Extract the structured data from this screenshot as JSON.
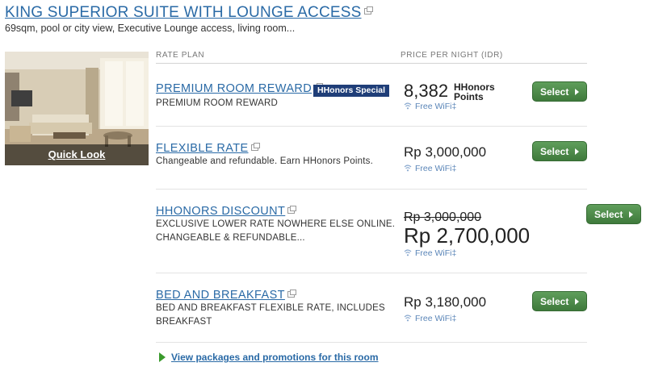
{
  "room": {
    "title": "KING SUPERIOR SUITE WITH LOUNGE ACCESS",
    "description": "69sqm, pool or city view, Executive Lounge access, living room...",
    "quick_look": "Quick Look"
  },
  "table": {
    "col_rate_plan": "RATE PLAN",
    "col_price": "PRICE PER NIGHT (IDR)"
  },
  "rates": [
    {
      "name": "PREMIUM ROOM REWARD",
      "badge": "HHonors Special",
      "description": "PREMIUM ROOM REWARD",
      "points": "8,382",
      "points_unit_line1": "HHonors",
      "points_unit_line2": "Points",
      "wifi": "Free WiFi‡",
      "select": "Select"
    },
    {
      "name": "FLEXIBLE RATE",
      "description": "Changeable and refundable. Earn HHonors Points.",
      "price": "Rp 3,000,000",
      "wifi": "Free WiFi‡",
      "select": "Select"
    },
    {
      "name": "HHONORS DISCOUNT",
      "description_line1": "EXCLUSIVE LOWER RATE NOWHERE ELSE ONLINE.",
      "description_line2": "CHANGEABLE & REFUNDABLE...",
      "old_price": "Rp 3,000,000",
      "price": "Rp 2,700,000",
      "wifi": "Free WiFi‡",
      "select": "Select"
    },
    {
      "name": "BED AND BREAKFAST",
      "description_line1": "BED AND BREAKFAST FLEXIBLE RATE, INCLUDES",
      "description_line2": "BREAKFAST",
      "price": "Rp 3,180,000",
      "wifi": "Free WiFi‡",
      "select": "Select"
    }
  ],
  "promo_link": "View packages and promotions for this room",
  "colors": {
    "link": "#2a6aa6",
    "button": "#4a8a47",
    "badge": "#1f3e78",
    "wifi": "#5b86b8"
  },
  "icons": [
    "external-link-icon",
    "wifi-icon",
    "chevron-right-icon",
    "play-arrow-icon"
  ]
}
